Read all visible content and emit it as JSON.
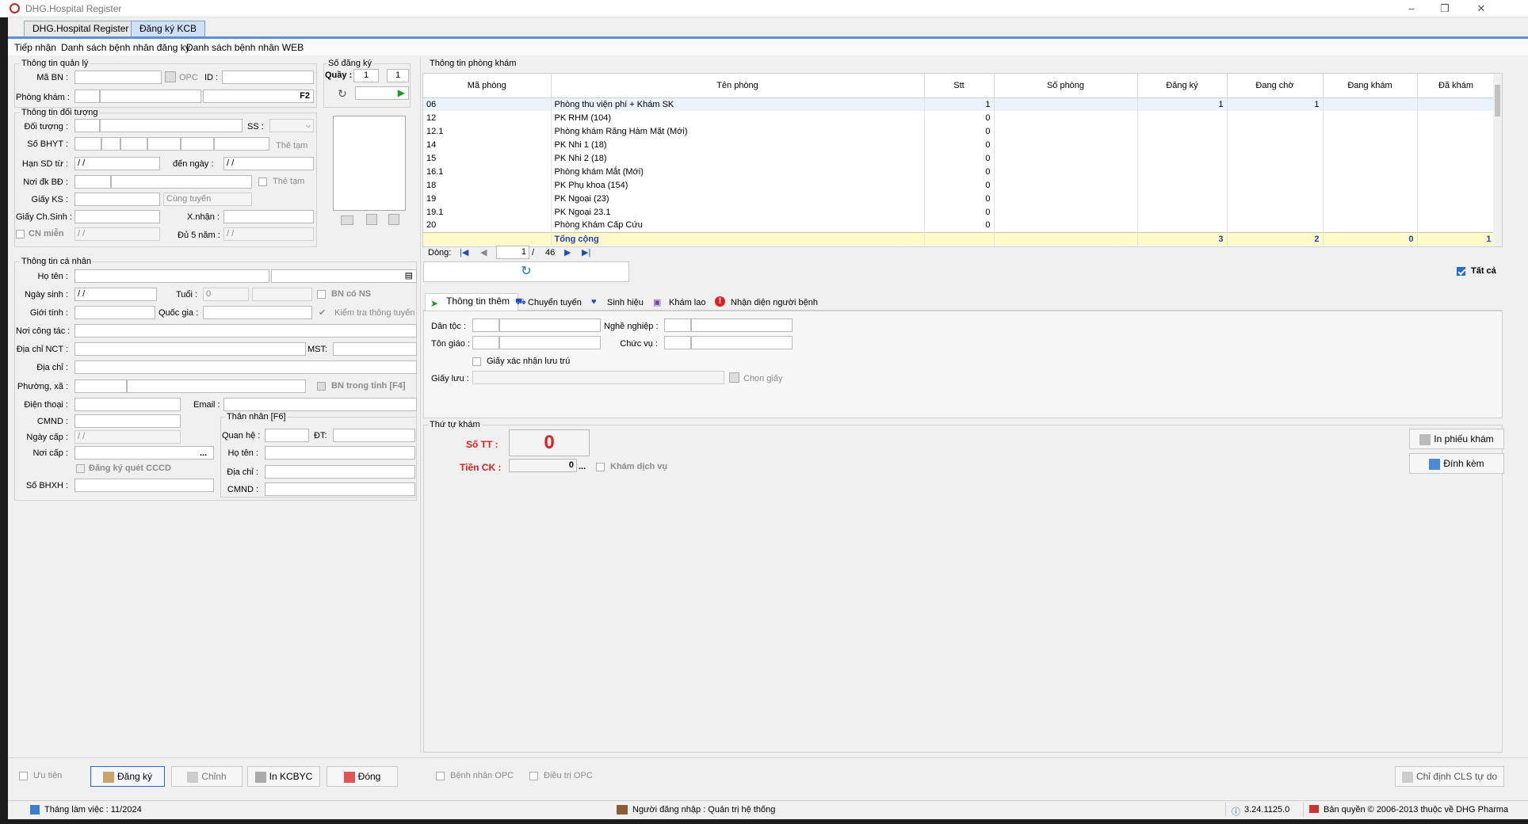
{
  "window": {
    "title": "DHG.Hospital Register"
  },
  "tabs": [
    "DHG.Hospital Register",
    "Đăng ký KCB"
  ],
  "menu": [
    "Tiếp nhận",
    "Danh sách bệnh nhân đăng ký",
    "Danh sách bệnh nhân WEB"
  ],
  "admin": {
    "group": "Thông tin quản lý",
    "ma_bn": "Mã BN :",
    "opc": "OPC",
    "id": "ID :",
    "phong_kham": "Phòng khám :",
    "f2": "F2"
  },
  "soDangKy": {
    "group": "Số đăng ký",
    "quay": "Quầy :",
    "v1": "1",
    "v2": "1"
  },
  "doiTuong": {
    "group": "Thông tin đối tượng",
    "doi_tuong": "Đối tượng :",
    "ss": "SS :",
    "so_bhyt": "Số BHYT :",
    "the_tam": "Thẻ tạm",
    "han_sd": "Hạn SD từ :",
    "den_ngay": "đến  ngày :",
    "noi_dk": "Nơi đk BĐ :",
    "the_tam2": "Thẻ tạm",
    "giay_ks": "Giấy KS :",
    "cung_tuyen": "Cùng tuyến",
    "giay_ch_sinh": "Giấy Ch.Sinh :",
    "x_nhan": "X.nhận :",
    "cn_mien": "CN miễn",
    "du5nam": "Đủ 5 năm :",
    "date_ph": "  /    /"
  },
  "caNhan": {
    "group": "Thông tin cá nhân",
    "ho_ten": "Họ tên :",
    "ngay_sinh": "Ngày sinh :",
    "tuoi": "Tuổi :",
    "tuoi_val": "0",
    "bn_co_ns": "BN có NS",
    "gioi_tinh": "Giới tính :",
    "quoc_gia": "Quốc gia :",
    "kiem_tra": "Kiểm tra thông tuyến",
    "noi_cong_tac": "Nơi công tác :",
    "dia_chi_nct": "Địa chỉ  NCT :",
    "mst": "MST:",
    "dia_chi": "Địa chỉ :",
    "phuong_xa": "Phường, xã :",
    "bn_trong_tinh": "BN trong tỉnh [F4]",
    "dien_thoai": "Điện thoại :",
    "email": "Email :",
    "cmnd": "CMND :",
    "ngay_cap": "Ngày cấp :",
    "noi_cap": "Nơi cấp :",
    "dang_ky_cccd": "Đăng ký quét CCCD",
    "so_bhxh": "Số BHXH :",
    "dots": "..."
  },
  "thanNhan": {
    "group": "Thân nhân [F6]",
    "quan_he": "Quan hệ :",
    "dt": "ĐT:",
    "ho_ten": "Họ tên :",
    "dia_chi": "Địa chỉ :",
    "cmnd": "CMND :"
  },
  "phongKham": {
    "group": "Thông tin phòng khám",
    "headers": [
      "Mã phòng",
      "Tên phòng",
      "Stt",
      "Số phòng",
      "Đăng ký",
      "Đang chờ",
      "Đang khám",
      "Đã khám"
    ],
    "rows": [
      [
        "06",
        "Phòng thu viện phí + Khám SK",
        "1",
        "",
        "1",
        "1",
        "",
        ""
      ],
      [
        "12",
        "PK RHM (104)",
        "0",
        "",
        "",
        "",
        "",
        ""
      ],
      [
        "12.1",
        "Phòng khám Răng Hàm Mặt (Mới)",
        "0",
        "",
        "",
        "",
        "",
        ""
      ],
      [
        "14",
        "PK Nhi 1 (18)",
        "0",
        "",
        "",
        "",
        "",
        ""
      ],
      [
        "15",
        "PK Nhi 2 (18)",
        "0",
        "",
        "",
        "",
        "",
        ""
      ],
      [
        "16.1",
        "Phòng khám Mắt (Mới)",
        "0",
        "",
        "",
        "",
        "",
        ""
      ],
      [
        "18",
        "PK Phụ khoa (154)",
        "0",
        "",
        "",
        "",
        "",
        ""
      ],
      [
        "19",
        "PK Ngoại (23)",
        "0",
        "",
        "",
        "",
        "",
        ""
      ],
      [
        "19.1",
        "PK Ngoại 23.1",
        "0",
        "",
        "",
        "",
        "",
        ""
      ],
      [
        "20",
        "Phòng Khám Cấp Cứu",
        "0",
        "",
        "",
        "",
        "",
        ""
      ]
    ],
    "total": [
      "",
      "Tổng cộng",
      "",
      "",
      "3",
      "2",
      "0",
      "1"
    ],
    "dong": "Dòng:",
    "page": "1",
    "of": "/",
    "pages": "46",
    "tat_ca": "Tất cả"
  },
  "subtabs": [
    "Thông tin thêm",
    "Chuyển tuyến",
    "Sinh hiệu",
    "Khám lao",
    "Nhận diện người bệnh"
  ],
  "extra": {
    "dan_toc": "Dân tộc :",
    "nghe_nghiep": "Nghề nghiệp :",
    "ton_giao": "Tôn giáo :",
    "chuc_vu": "Chức vụ :",
    "giay_xn": "Giấy xác nhận lưu trú",
    "giay_luu": "Giấy lưu :",
    "chon_giay": "Chọn giấy"
  },
  "thuTu": {
    "group": "Thứ tự khám",
    "so_tt": "Số TT :",
    "so_tt_val": "0",
    "tien_ck": "Tiền CK :",
    "tien_ck_val": "0",
    "dots": "...",
    "kham_dv": "Khám dịch vụ",
    "in_phieu": "In phiếu khám",
    "dinh_kem": "Đính kèm"
  },
  "bottom": {
    "uu_tien": "Ưu tiên",
    "dang_ky": "Đăng ký",
    "chinh": "Chỉnh",
    "in_kcbyc": "In KCBYC",
    "dong": "Đóng",
    "bn_opc": "Bệnh nhân OPC",
    "dieu_tri_opc": "Điều trị OPC",
    "chi_dinh": "Chỉ định CLS tự do"
  },
  "status": {
    "thang": "Tháng làm việc : 11/2024",
    "nguoi": "Người đăng nhập : Quản trị hệ thống",
    "version": "3.24.1125.0",
    "copyright": "Bản quyền © 2006-2013 thuộc về DHG Pharma"
  },
  "colors": {
    "accent": "#1e6fd0",
    "red": "#e02020",
    "tabline": "#5b8fd6",
    "total_bg": "#fffbc8"
  }
}
